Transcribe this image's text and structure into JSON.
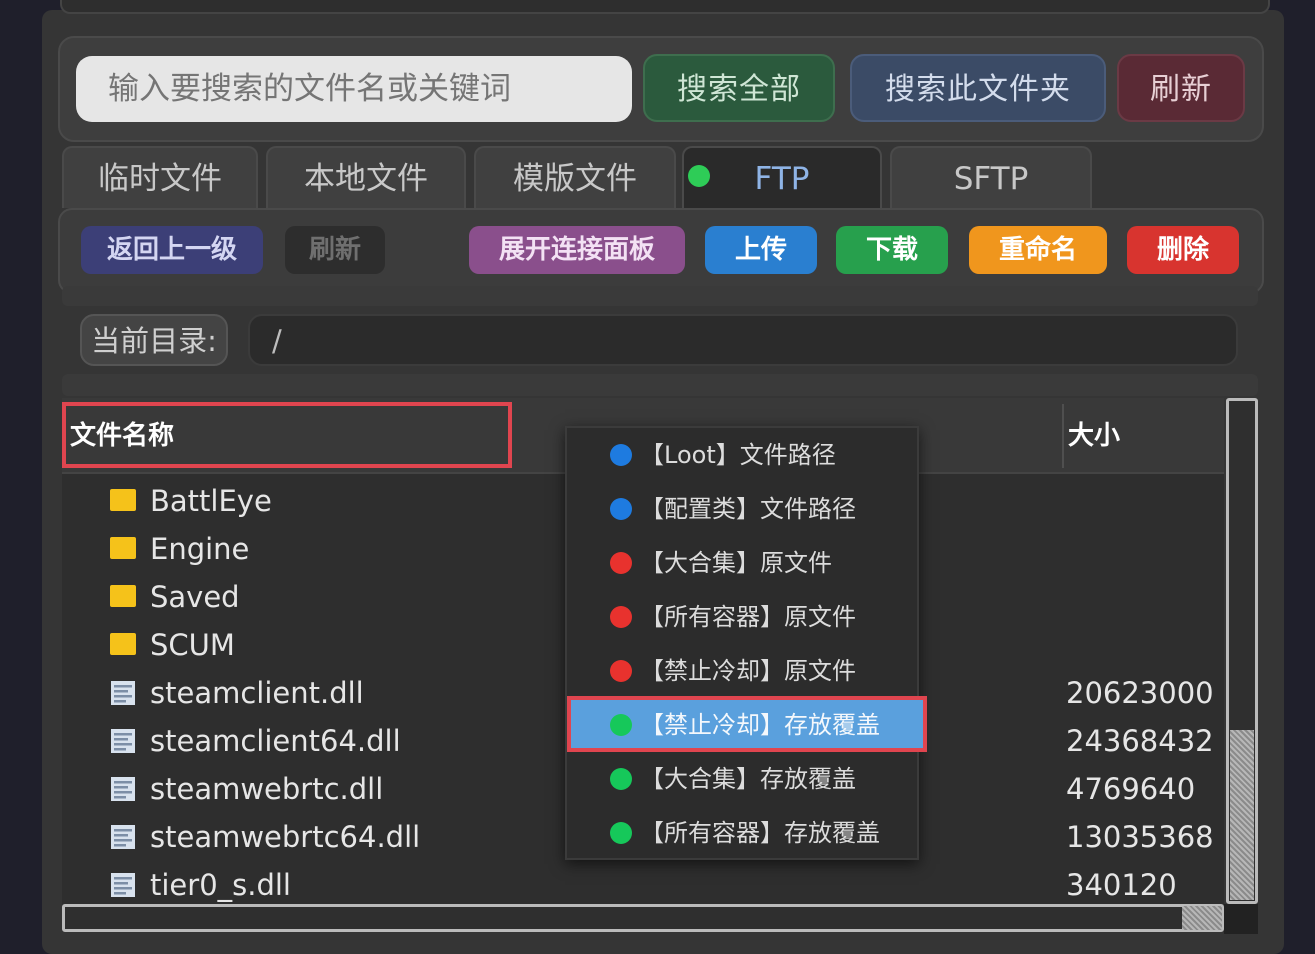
{
  "search": {
    "placeholder": "输入要搜索的文件名或关键词",
    "search_all_label": "搜索全部",
    "search_folder_label": "搜索此文件夹",
    "refresh_label": "刷新"
  },
  "tabs": [
    {
      "label": "临时文件"
    },
    {
      "label": "本地文件"
    },
    {
      "label": "模版文件"
    },
    {
      "label": "FTP",
      "active": true,
      "status_color": "#2ecc57"
    },
    {
      "label": "SFTP"
    }
  ],
  "toolbar": {
    "back_label": "返回上一级",
    "refresh_label": "刷新",
    "expand_label": "展开连接面板",
    "upload_label": "上传",
    "download_label": "下载",
    "rename_label": "重命名",
    "delete_label": "删除"
  },
  "directory": {
    "label": "当前目录:",
    "path": "/"
  },
  "file_list": {
    "columns": {
      "name": "文件名称",
      "size": "大小"
    },
    "rows": [
      {
        "name": "BattlEye",
        "type": "folder",
        "size": ""
      },
      {
        "name": "Engine",
        "type": "folder",
        "size": ""
      },
      {
        "name": "Saved",
        "type": "folder",
        "size": ""
      },
      {
        "name": "SCUM",
        "type": "folder",
        "size": ""
      },
      {
        "name": "steamclient.dll",
        "type": "file",
        "size": "20623000"
      },
      {
        "name": "steamclient64.dll",
        "type": "file",
        "size": "24368432"
      },
      {
        "name": "steamwebrtc.dll",
        "type": "file",
        "size": "4769640"
      },
      {
        "name": "steamwebrtc64.dll",
        "type": "file",
        "size": "13035368"
      },
      {
        "name": "tier0_s.dll",
        "type": "file",
        "size": "340120"
      }
    ]
  },
  "context_menu": {
    "items": [
      {
        "label": "【Loot】文件路径",
        "color": "#1e7be0"
      },
      {
        "label": "【配置类】文件路径",
        "color": "#1e7be0"
      },
      {
        "label": "【大合集】原文件",
        "color": "#e8322e"
      },
      {
        "label": "【所有容器】原文件",
        "color": "#e8322e"
      },
      {
        "label": "【禁止冷却】原文件",
        "color": "#e8322e"
      },
      {
        "label": "【禁止冷却】存放覆盖",
        "color": "#16c85a",
        "highlighted": true
      },
      {
        "label": "【大合集】存放覆盖",
        "color": "#16c85a"
      },
      {
        "label": "【所有容器】存放覆盖",
        "color": "#16c85a"
      }
    ]
  }
}
